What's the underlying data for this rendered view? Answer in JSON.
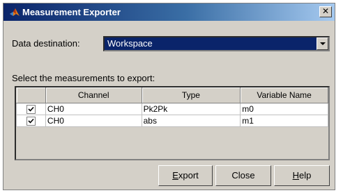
{
  "window": {
    "title": "Measurement Exporter",
    "close_glyph": "✕"
  },
  "destination": {
    "label": "Data destination:",
    "value": "Workspace"
  },
  "measurements": {
    "label": "Select the measurements to export:",
    "columns": [
      "Channel",
      "Type",
      "Variable Name"
    ],
    "rows": [
      {
        "checked": true,
        "channel": "CH0",
        "type": "Pk2Pk",
        "variable": "m0"
      },
      {
        "checked": true,
        "channel": "CH0",
        "type": "abs",
        "variable": "m1"
      }
    ]
  },
  "buttons": {
    "export": {
      "mnemonic": "E",
      "rest": "xport"
    },
    "close": {
      "label": "Close"
    },
    "help": {
      "mnemonic": "H",
      "rest": "elp"
    }
  },
  "colors": {
    "title_bar": "#0a246a",
    "selection": "#0a246a",
    "face": "#d4d0c8"
  }
}
